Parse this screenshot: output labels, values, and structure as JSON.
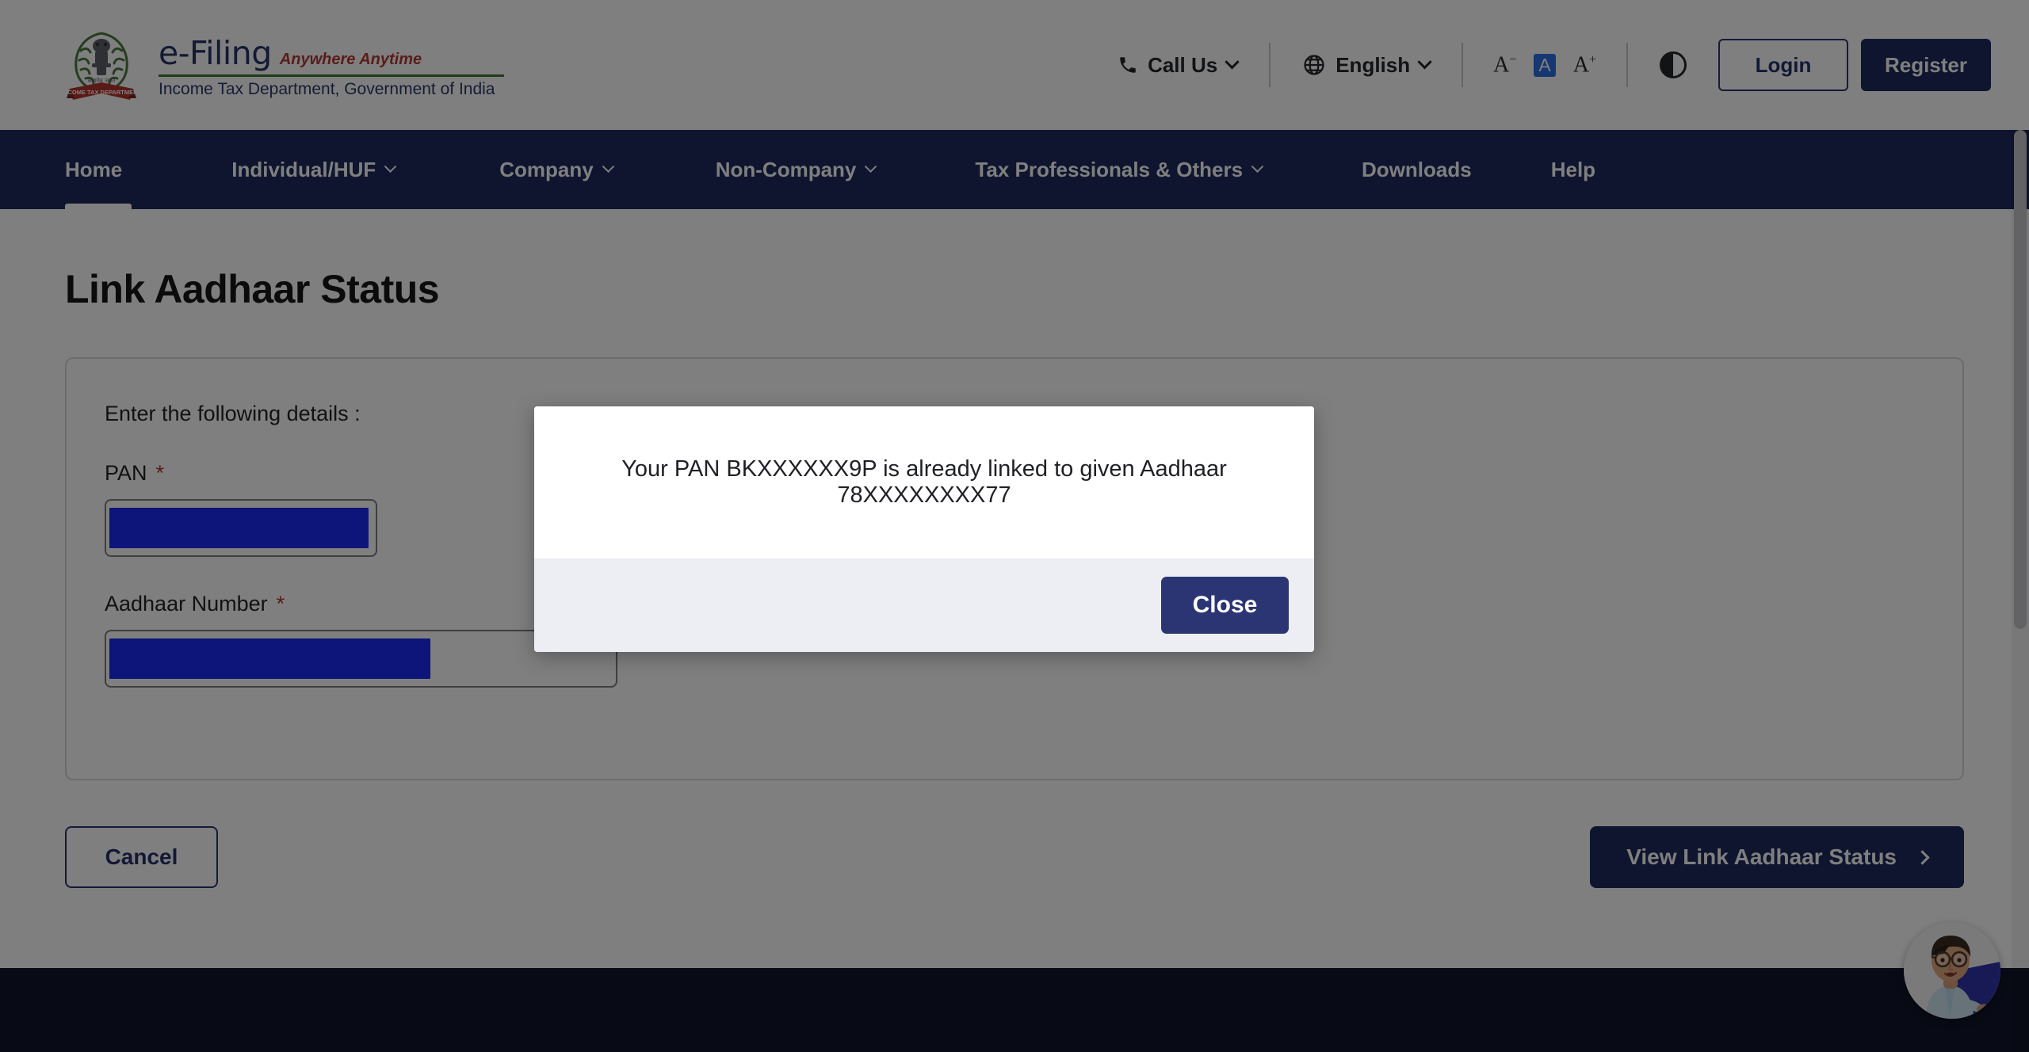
{
  "header": {
    "brand": {
      "efiling": "e-Filing",
      "tagline": "Anywhere Anytime",
      "department": "Income Tax Department, Government of India",
      "emblem_alt": "national-emblem-of-india"
    },
    "call_us": "Call Us",
    "language": "English",
    "font_decrease": "A",
    "font_normal": "A",
    "font_increase": "A",
    "contrast": "contrast-toggle",
    "login": "Login",
    "register": "Register"
  },
  "nav": {
    "items": [
      {
        "label": "Home",
        "has_dropdown": false,
        "active": true
      },
      {
        "label": "Individual/HUF",
        "has_dropdown": true,
        "active": false
      },
      {
        "label": "Company",
        "has_dropdown": true,
        "active": false
      },
      {
        "label": "Non-Company",
        "has_dropdown": true,
        "active": false
      },
      {
        "label": "Tax Professionals & Others",
        "has_dropdown": true,
        "active": false
      },
      {
        "label": "Downloads",
        "has_dropdown": false,
        "active": false
      },
      {
        "label": "Help",
        "has_dropdown": false,
        "active": false
      }
    ]
  },
  "main": {
    "title": "Link Aadhaar Status",
    "intro": "Enter the following details :",
    "fields": [
      {
        "label": "PAN",
        "required": "*",
        "value": "",
        "redacted": true
      },
      {
        "label": "Aadhaar Number",
        "required": "*",
        "value": "",
        "redacted": true
      }
    ],
    "cancel": "Cancel",
    "submit": "View Link Aadhaar Status"
  },
  "modal": {
    "message": "Your PAN BKXXXXXX9P is already linked to given Aadhaar 78XXXXXXXX77",
    "close": "Close"
  },
  "chat": {
    "avatar_alt": "chatbot-assistant-avatar"
  },
  "colors": {
    "navy": "#1f2a5e",
    "modal_button": "#2b3573",
    "redaction_blue": "#1a2bf5",
    "required_red": "#b4362f",
    "brand_green": "#3d7a3a",
    "footer": "#10142a"
  }
}
